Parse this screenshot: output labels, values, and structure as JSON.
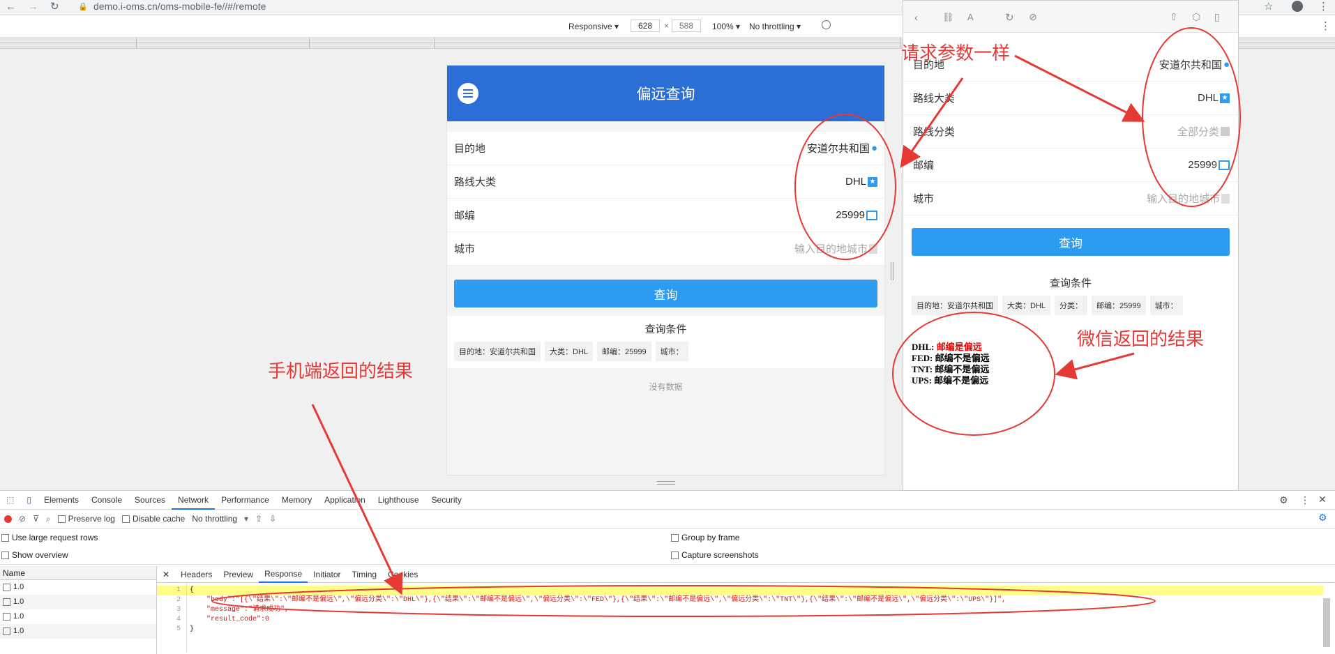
{
  "browser": {
    "url": "demo.i-oms.cn/oms-mobile-fe//#/remote",
    "device": "Responsive ▾",
    "width": "628",
    "height": "588",
    "zoom": "100% ▾",
    "throttle": "No throttling ▾"
  },
  "app": {
    "title": "偏远查询",
    "fields": [
      {
        "label": "目的地",
        "value": "安道尔共和国"
      },
      {
        "label": "路线大类",
        "value": "DHL"
      },
      {
        "label": "邮编",
        "value": "25999"
      },
      {
        "label": "城市",
        "placeholder": "输入目的地城市"
      }
    ],
    "query_button": "查询",
    "conditions_title": "查询条件",
    "chips": [
      "目的地：安道尔共和国",
      "大类：DHL",
      "邮编：25999",
      "城市："
    ],
    "no_data": "没有数据"
  },
  "wechat": {
    "fields": [
      {
        "label": "目的地",
        "value": "安道尔共和国"
      },
      {
        "label": "路线大类",
        "value": "DHL"
      },
      {
        "label": "路线分类",
        "placeholder": "全部分类"
      },
      {
        "label": "邮编",
        "value": "25999"
      },
      {
        "label": "城市",
        "placeholder": "输入目的地城市"
      }
    ],
    "query_button": "查询",
    "conditions_title": "查询条件",
    "chips": [
      "目的地：安道尔共和国",
      "大类：DHL",
      "分类：",
      "邮编：25999",
      "城市："
    ],
    "results": [
      {
        "carrier": "DHL",
        "text": "邮编是偏远"
      },
      {
        "carrier": "FED",
        "text": "邮编不是偏远"
      },
      {
        "carrier": "TNT",
        "text": "邮编不是偏远"
      },
      {
        "carrier": "UPS",
        "text": "邮编不是偏远"
      }
    ]
  },
  "devtools": {
    "tabs": [
      "Elements",
      "Console",
      "Sources",
      "Network",
      "Performance",
      "Memory",
      "Application",
      "Lighthouse",
      "Security"
    ],
    "preserve_log": "Preserve log",
    "disable_cache": "Disable cache",
    "throttle": "No throttling",
    "opt_large_rows": "Use large request rows",
    "opt_overview": "Show overview",
    "opt_group": "Group by frame",
    "opt_capture": "Capture screenshots",
    "name_header": "Name",
    "names": [
      "1.0",
      "1.0",
      "1.0",
      "1.0"
    ],
    "response_tabs": [
      "Headers",
      "Preview",
      "Response",
      "Initiator",
      "Timing",
      "Cookies"
    ],
    "code_lines": [
      "{",
      "    \"body\":\"[{\\\"结果\\\":\\\"邮编不是偏远\\\",\\\"偏远分类\\\":\\\"DHL\\\"},{\\\"结果\\\":\\\"邮编不是偏远\\\",\\\"偏远分类\\\":\\\"FED\\\"},{\\\"结果\\\":\\\"邮编不是偏远\\\",\\\"偏远分类\\\":\\\"TNT\\\"},{\\\"结果\\\":\\\"邮编不是偏远\\\",\\\"偏远分类\\\":\\\"UPS\\\"}]\",",
      "    \"message\":\"请求成功\",",
      "    \"result_code\":0",
      "}"
    ]
  },
  "annotations": {
    "params_same": "请求参数一样",
    "wechat_result": "微信返回的结果",
    "mobile_result": "手机端返回的结果"
  }
}
